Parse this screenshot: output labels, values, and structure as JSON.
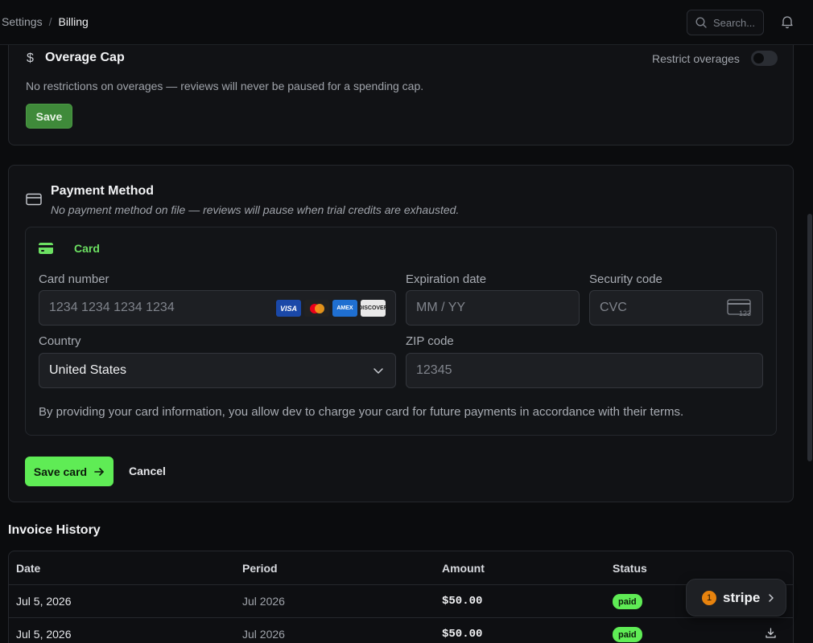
{
  "breadcrumb": {
    "parent": "Settings",
    "separator": "/",
    "current": "Billing"
  },
  "search": {
    "placeholder": "Search..."
  },
  "overage": {
    "icon": "dollar-icon",
    "icon_glyph": "$",
    "title": "Overage Cap",
    "toggle_label": "Restrict overages",
    "toggle_on": false,
    "description": "No restrictions on overages — reviews will never be paused for a spending cap.",
    "save_label": "Save"
  },
  "payment": {
    "title": "Payment Method",
    "subtitle": "No payment method on file — reviews will pause when trial credits are exhausted.",
    "tab_label": "Card",
    "card_number_label": "Card number",
    "card_number_placeholder": "1234 1234 1234 1234",
    "brands": [
      "VISA",
      "Mastercard",
      "AMEX",
      "DISCOVER"
    ],
    "expiry_label": "Expiration date",
    "expiry_placeholder": "MM / YY",
    "cvc_label": "Security code",
    "cvc_placeholder": "CVC",
    "cvc_icon_text": "123",
    "country_label": "Country",
    "country_value": "United States",
    "zip_label": "ZIP code",
    "zip_placeholder": "12345",
    "disclaimer": "By providing your card information, you allow dev to charge your card for future payments in accordance with their terms.",
    "save_card_label": "Save card",
    "cancel_label": "Cancel"
  },
  "invoices": {
    "title": "Invoice History",
    "headers": {
      "date": "Date",
      "period": "Period",
      "amount": "Amount",
      "status": "Status"
    },
    "rows": [
      {
        "date": "Jul 5, 2026",
        "period": "Jul 2026",
        "amount": "$50.00",
        "status": "paid"
      },
      {
        "date": "Jul 5, 2026",
        "period": "Jul 2026",
        "amount": "$50.00",
        "status": "paid"
      }
    ]
  },
  "stripe_widget": {
    "count": "1",
    "label": "stripe"
  },
  "colors": {
    "accent": "#5fec55",
    "save_dark": "#3f8a3a",
    "notification": "#e8830e"
  }
}
